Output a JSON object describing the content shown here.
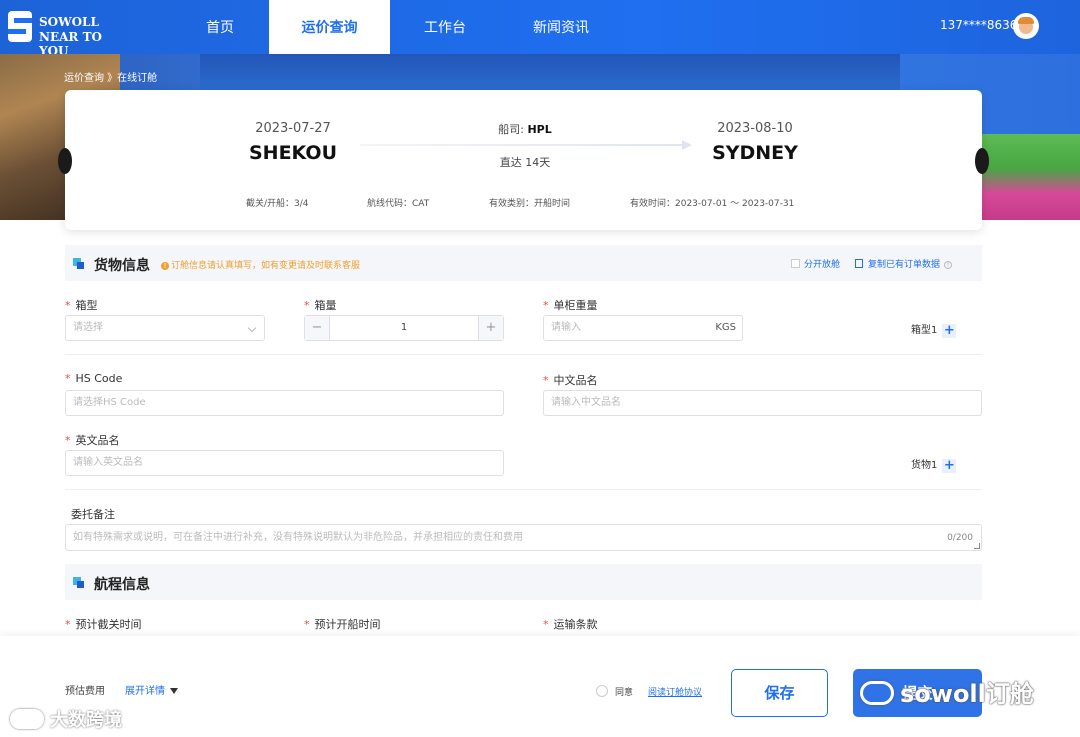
{
  "brand": {
    "line1": "SOWOLL",
    "line2": "NEAR TO YOU"
  },
  "nav": {
    "items": [
      {
        "label": "首页"
      },
      {
        "label": "运价查询"
      },
      {
        "label": "工作台"
      },
      {
        "label": "新闻资讯"
      }
    ],
    "active_index": 1,
    "phone": "137****8636"
  },
  "breadcrumb": "运价查询 》在线订舱",
  "route": {
    "origin_date": "2023-07-27",
    "origin_port": "SHEKOU",
    "dest_date": "2023-08-10",
    "dest_port": "SYDNEY",
    "carrier_label": "船司:",
    "carrier": "HPL",
    "transit": "直达 14天",
    "meta": [
      "截关/开船：3/4",
      "航线代码：CAT",
      "有效类别：开船时间",
      "有效时间：2023-07-01 ～ 2023-07-31"
    ]
  },
  "cargo": {
    "title": "货物信息",
    "hint": "订舱信息请认真填写，如有变更请及时联系客服",
    "hint_icon": "!",
    "split_label": "分开放舱",
    "copy_label": "复制已有订单数据",
    "help_icon": "?",
    "box_type": {
      "label": "箱型",
      "placeholder": "请选择"
    },
    "box_qty": {
      "label": "箱量",
      "value": "1",
      "minus": "−",
      "plus": "+"
    },
    "weight": {
      "label": "单柜重量",
      "placeholder": "请输入",
      "unit": "KGS"
    },
    "box_add": "箱型1",
    "hs_code": {
      "label": "HS Code",
      "placeholder": "请选择HS Code"
    },
    "cn_name": {
      "label": "中文品名",
      "placeholder": "请输入中文品名"
    },
    "en_name": {
      "label": "英文品名",
      "placeholder": "请输入英文品名"
    },
    "goods_add": "货物1",
    "plus_glyph": "+",
    "required_mark": "*",
    "remark": {
      "label": "委托备注",
      "placeholder": "如有特殊需求或说明，可在备注中进行补充，没有特殊说明默认为非危险品，并承担相应的责任和费用",
      "counter": "0/200"
    }
  },
  "voyage": {
    "title": "航程信息",
    "cutoff_label": "预计截关时间",
    "sail_label": "预计开船时间",
    "terms_label": "运输条款"
  },
  "footer": {
    "estimate_label": "预估费用",
    "expand_label": "展开详情",
    "agree_label": "同意",
    "agreement_link": "阅读订舱协议",
    "save_label": "保存",
    "submit_label": "提交"
  },
  "watermarks": {
    "right": "sowoll订舱",
    "left": "大数跨境"
  },
  "colors": {
    "accent": "#1f6ff0",
    "required": "#e74c3c",
    "hint": "#f0a030"
  }
}
